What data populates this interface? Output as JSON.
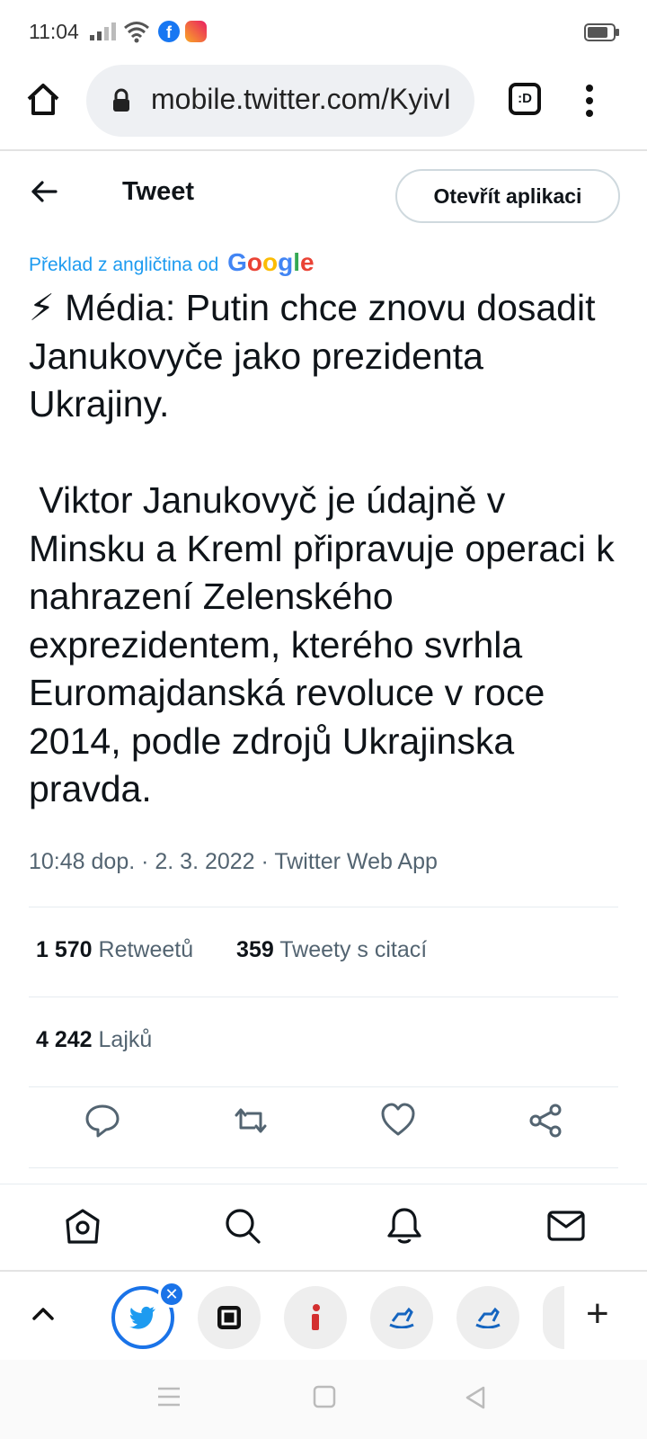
{
  "status_bar": {
    "time": "11:04",
    "icons": [
      "signal-icon",
      "wifi-icon",
      "facebook-icon",
      "instagram-icon",
      "battery-icon"
    ]
  },
  "browser": {
    "url": "mobile.twitter.com/KyivI",
    "tab_switcher_label": ":D"
  },
  "header": {
    "title": "Tweet",
    "open_app_label": "Otevřít aplikaci"
  },
  "tweet": {
    "translation_note": "Překlad z angličtina od",
    "translation_provider": "Google",
    "text": "⚡ Média: Putin chce znovu dosadit Janukovyče jako prezidenta Ukrajiny.\n\n Viktor Janukovyč je údajně v Minsku a Kreml připravuje operaci k nahrazení Zelenského exprezidentem, kterého svrhla Euromajdanská revoluce v roce 2014, podle zdrojů Ukrajinska pravda.",
    "meta": "10:48 dop. · 2. 3. 2022 · Twitter Web App",
    "retweets_count": "1 570",
    "retweets_label": "Retweetů",
    "quotes_count": "359",
    "quotes_label": "Tweety s citací",
    "likes_count": "4 242",
    "likes_label": "Lajků"
  },
  "colors": {
    "accent": "#1d9bf0",
    "tab_active": "#1a73e8",
    "text_secondary": "#536471"
  }
}
